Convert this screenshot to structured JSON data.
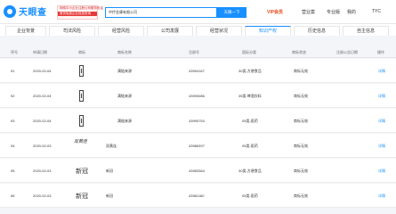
{
  "header": {
    "logo_text": "天眼查",
    "promo_line1": "网络中小企业注册公司服务电话",
    "promo_line2": "首页免费企业信息查询",
    "search_value": "中疗金康有限公司",
    "search_button": "天眼一下",
    "vip": "VIP会员",
    "nav_items": [
      "营业案",
      "专业版",
      "我的",
      "TYC"
    ]
  },
  "tabs": [
    {
      "label": "企业背景",
      "count": ""
    },
    {
      "label": "司法风险",
      "count": ""
    },
    {
      "label": "经营风险",
      "count": ""
    },
    {
      "label": "公司发展",
      "count": ""
    },
    {
      "label": "经营状况",
      "count": ""
    },
    {
      "label": "知识产权",
      "count": ""
    },
    {
      "label": "历史信息",
      "count": ""
    },
    {
      "label": "自主信息",
      "count": ""
    }
  ],
  "table": {
    "columns": [
      "序号",
      "申请日期",
      "商标",
      "商标名称",
      "注册号",
      "国际分类",
      "商标状态",
      "注册公告日期",
      "操作"
    ],
    "rows": [
      {
        "index": "91",
        "date": "2020-02-04",
        "name": "满链来源",
        "reg_no": "43994167",
        "category": "30类-方便食品",
        "status": "商标无效",
        "pub_date": "",
        "action": "详情",
        "logo": "mark"
      },
      {
        "index": "92",
        "date": "2020-02-04",
        "name": "满链来源",
        "reg_no": "43993086",
        "category": "35类-啤酒饮料",
        "status": "商标无效",
        "pub_date": "",
        "action": "详情",
        "logo": "mark"
      },
      {
        "index": "93",
        "date": "2020-02-04",
        "name": "满链来源",
        "reg_no": "43990753",
        "category": "05类-医药",
        "status": "商标无效",
        "pub_date": "",
        "action": "详情",
        "logo": "mark"
      },
      {
        "index": "94",
        "date": "2020-02-03",
        "name": "双黄连",
        "reg_no": "43986397",
        "category": "05类-医药",
        "status": "商标无效",
        "pub_date": "",
        "action": "详情",
        "logo": "calli",
        "logo_text": "双黄连"
      },
      {
        "index": "95",
        "date": "2020-02-03",
        "name": "新冠",
        "reg_no": "43983384",
        "category": "30类-方便食品",
        "status": "商标无效",
        "pub_date": "",
        "action": "详情",
        "logo": "xin",
        "logo_text": "新冠"
      },
      {
        "index": "96",
        "date": "2020-02-03",
        "name": "新冠",
        "reg_no": "43981160",
        "category": "05类-医药",
        "status": "商标无效",
        "pub_date": "",
        "action": "详情",
        "logo": "xin",
        "logo_text": "新冠"
      }
    ]
  }
}
